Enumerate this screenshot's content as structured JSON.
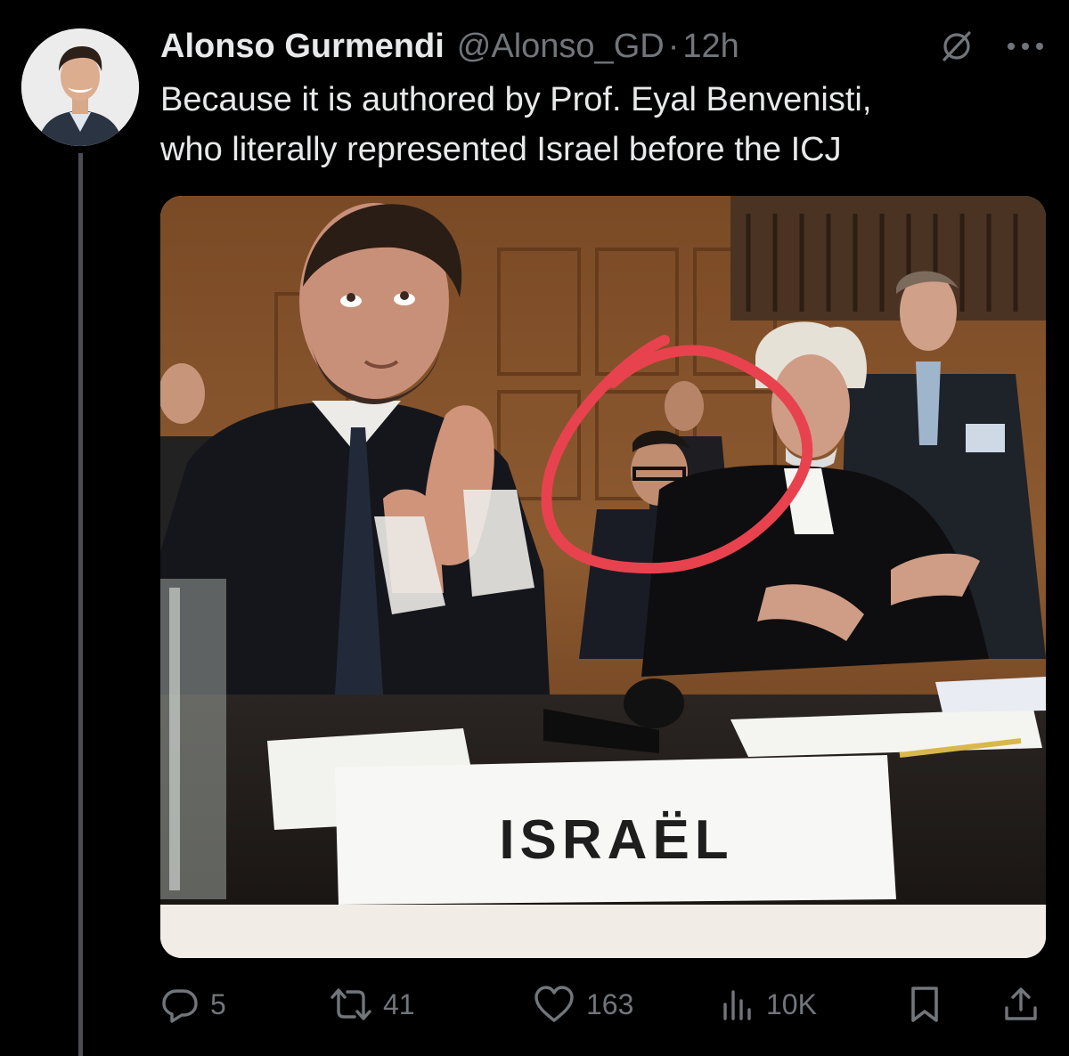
{
  "tweet": {
    "author_name": "Alonso Gurmendi",
    "author_handle": "@Alonso_GD",
    "separator": "·",
    "timestamp": "12h",
    "text": "Because it is authored by Prof. Eyal Benvenisti,\nwho literally represented Israel before the ICJ"
  },
  "media": {
    "placard_text": "ISRAËL",
    "highlight_color": "#e8424f"
  },
  "actions": {
    "replies": "5",
    "reposts": "41",
    "likes": "163",
    "views": "10K"
  },
  "icons": {
    "header": [
      "grok-icon",
      "more-icon"
    ],
    "actions": [
      "reply-icon",
      "repost-icon",
      "like-icon",
      "views-icon",
      "bookmark-icon",
      "share-icon"
    ]
  },
  "colors": {
    "background": "#000000",
    "text_primary": "#e7e9ea",
    "text_secondary": "#71767b",
    "thread_line": "#4a4d52"
  }
}
